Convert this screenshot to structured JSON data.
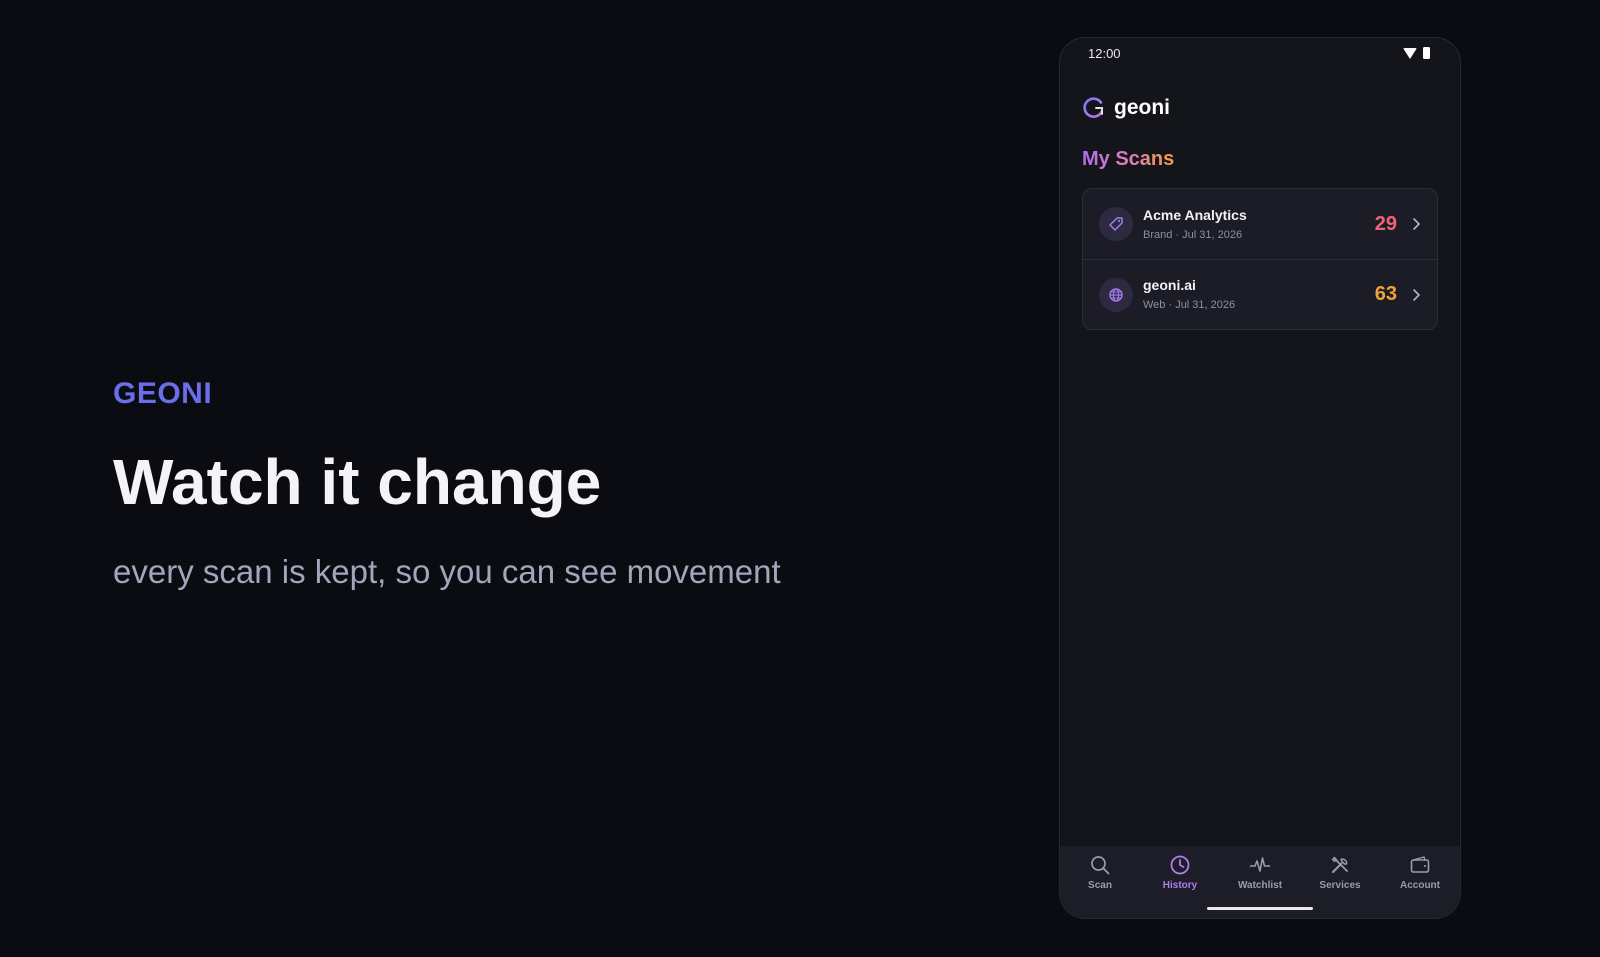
{
  "hero": {
    "eyebrow": "GEONI",
    "headline": "Watch it change",
    "subline": "every scan is kept, so you can see movement"
  },
  "phone": {
    "status_time": "12:00",
    "app_name": "geoni",
    "section_title": "My Scans",
    "scans": [
      {
        "name": "Acme Analytics",
        "meta": "Brand · Jul 31, 2026",
        "score": "29",
        "icon": "tag-icon",
        "score_color": "#f2617a"
      },
      {
        "name": "geoni.ai",
        "meta": "Web · Jul 31, 2026",
        "score": "63",
        "icon": "globe-icon",
        "score_color": "#f0a236"
      }
    ],
    "nav": [
      {
        "label": "Scan",
        "icon": "search-icon",
        "active": false
      },
      {
        "label": "History",
        "icon": "clock-icon",
        "active": true
      },
      {
        "label": "Watchlist",
        "icon": "pulse-icon",
        "active": false
      },
      {
        "label": "Services",
        "icon": "tools-icon",
        "active": false
      },
      {
        "label": "Account",
        "icon": "wallet-icon",
        "active": false
      }
    ]
  },
  "colors": {
    "accent": "#6a6ee8",
    "active_nav": "#b07cf2"
  }
}
